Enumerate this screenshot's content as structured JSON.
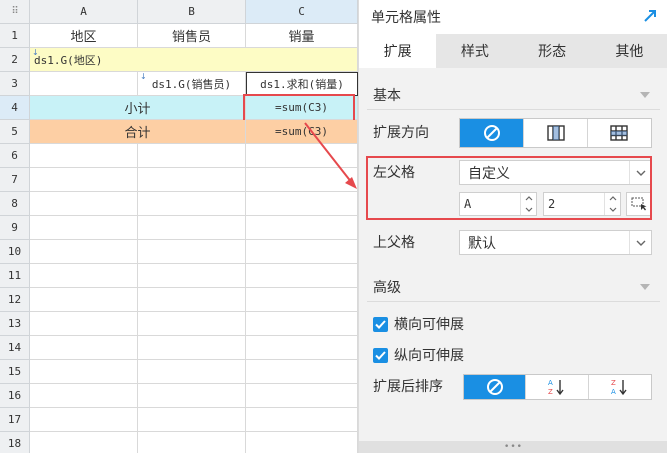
{
  "sheet": {
    "corner_glyph": "⠿",
    "columns": [
      "A",
      "B",
      "C"
    ],
    "rows": [
      "1",
      "2",
      "3",
      "4",
      "5",
      "6",
      "7",
      "8",
      "9",
      "10",
      "11",
      "12",
      "13",
      "14",
      "15",
      "16",
      "17",
      "18"
    ],
    "cells": {
      "a1": "地区",
      "b1": "销售员",
      "c1": "销量",
      "a2": "ds1.G(地区)",
      "b3": "ds1.G(销售员)",
      "c3": "ds1.求和(销量)",
      "ab4": "小计",
      "c4": "=sum(C3)",
      "ab5": "合计",
      "c5": "=sum(C3)"
    }
  },
  "panel": {
    "title": "单元格属性",
    "tabs": [
      "扩展",
      "样式",
      "形态",
      "其他"
    ],
    "basic": {
      "heading": "基本",
      "expand_direction_label": "扩展方向",
      "left_parent_label": "左父格",
      "left_parent_value": "自定义",
      "left_parent_col": "A",
      "left_parent_row": "2",
      "top_parent_label": "上父格",
      "top_parent_value": "默认"
    },
    "advanced": {
      "heading": "高级",
      "horizontal_expand_label": "横向可伸展",
      "vertical_expand_label": "纵向可伸展",
      "sort_after_expand_label": "扩展后排序"
    }
  },
  "colors": {
    "accent": "#1a8fe3",
    "highlight": "#e6494d",
    "yellow_fill": "#fdfcc5",
    "cyan_fill": "#c8f2f7",
    "orange_fill": "#fdcfa4"
  }
}
